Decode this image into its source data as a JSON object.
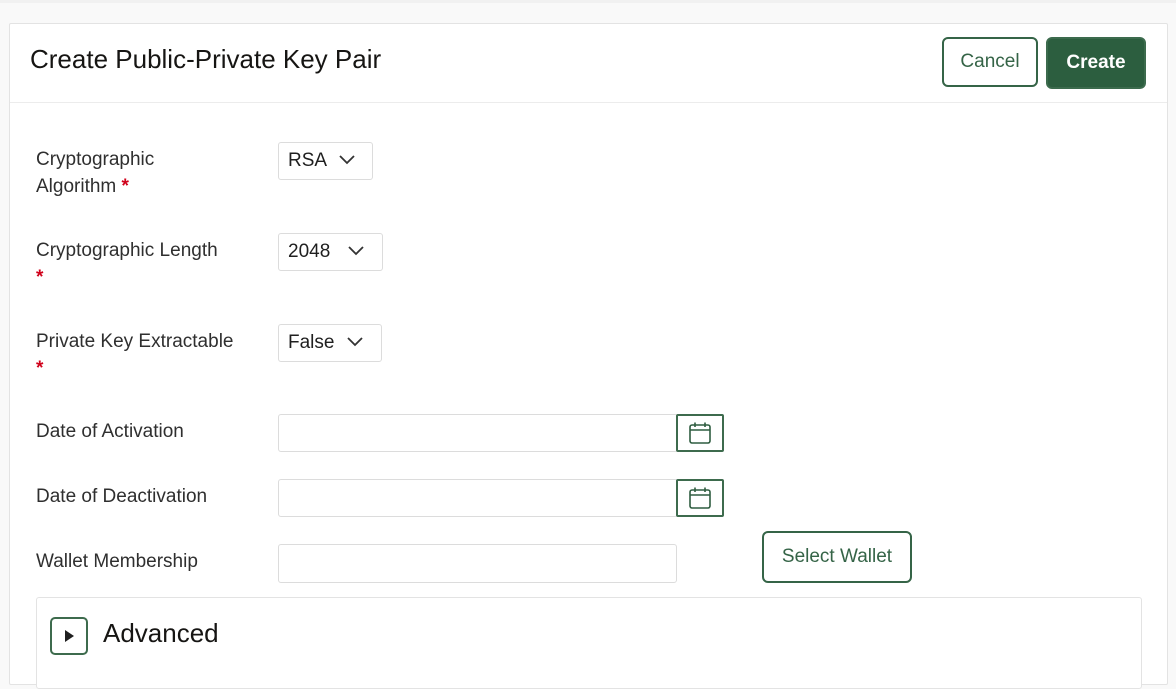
{
  "dialog": {
    "title": "Create Public-Private Key Pair",
    "cancel_label": "Cancel",
    "create_label": "Create"
  },
  "form": {
    "algorithm": {
      "label": "Cryptographic Algorithm",
      "required_mark": "*",
      "value": "RSA"
    },
    "length": {
      "label": "Cryptographic Length",
      "required_mark": "*",
      "value": "2048"
    },
    "extractable": {
      "label": "Private Key Extractable",
      "required_mark": "*",
      "value": "False"
    },
    "activation": {
      "label": "Date of Activation",
      "value": ""
    },
    "deactivation": {
      "label": "Date of Deactivation",
      "value": ""
    },
    "wallet": {
      "label": "Wallet Membership",
      "value": "",
      "select_label": "Select Wallet"
    }
  },
  "advanced": {
    "label": "Advanced"
  },
  "colors": {
    "accent": "#2c5e3f",
    "required": "#d0021b"
  }
}
